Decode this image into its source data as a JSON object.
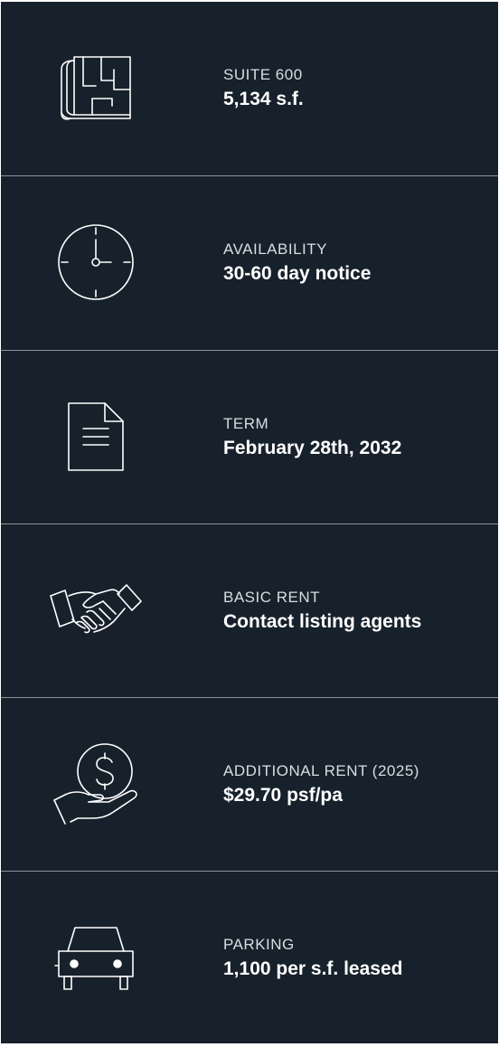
{
  "rows": [
    {
      "icon": "floor-plan-icon",
      "label": "SUITE 600",
      "value": "5,134 s.f."
    },
    {
      "icon": "clock-icon",
      "label": "AVAILABILITY",
      "value": "30-60 day notice"
    },
    {
      "icon": "document-icon",
      "label": "TERM",
      "value": "February 28th, 2032"
    },
    {
      "icon": "handshake-icon",
      "label": "BASIC RENT",
      "value": "Contact listing agents"
    },
    {
      "icon": "dollar-hand-icon",
      "label": "ADDITIONAL RENT (2025)",
      "value": "$29.70 psf/pa"
    },
    {
      "icon": "car-icon",
      "label": "PARKING",
      "value": "1,100 per s.f. leased"
    }
  ],
  "colors": {
    "background": "#17212b",
    "divider": "#8a939c",
    "label": "#d8dde2",
    "value": "#ffffff"
  }
}
